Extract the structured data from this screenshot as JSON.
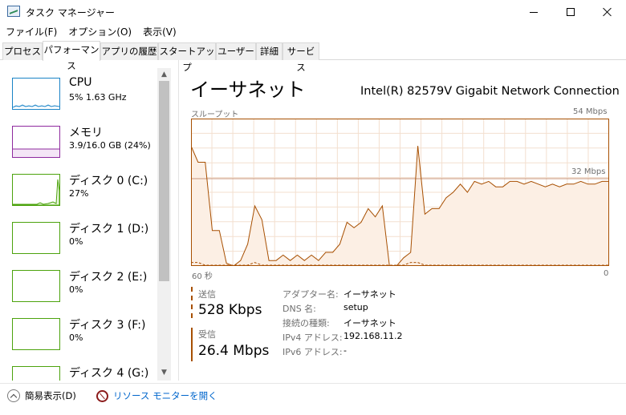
{
  "window": {
    "title": "タスク マネージャー"
  },
  "menu": [
    "ファイル(F)",
    "オプション(O)",
    "表示(V)"
  ],
  "tabs": [
    "プロセス",
    "パフォーマンス",
    "アプリの履歴",
    "スタートアップ",
    "ユーザー",
    "詳細",
    "サービス"
  ],
  "active_tab": "パフォーマンス",
  "resources": [
    {
      "name": "CPU",
      "sub": "5%  1.63 GHz",
      "color": "#1a83c6",
      "icon": "cpu-graph"
    },
    {
      "name": "メモリ",
      "sub": "3.9/16.0 GB (24%)",
      "color": "#8e2a9e",
      "icon": "memory-graph"
    },
    {
      "name": "ディスク 0 (C:)",
      "sub": "27%",
      "color": "#4ca30d",
      "icon": "disk-graph"
    },
    {
      "name": "ディスク 1 (D:)",
      "sub": "0%",
      "color": "#4ca30d",
      "icon": "disk-graph"
    },
    {
      "name": "ディスク 2 (E:)",
      "sub": "0%",
      "color": "#4ca30d",
      "icon": "disk-graph"
    },
    {
      "name": "ディスク 3 (F:)",
      "sub": "0%",
      "color": "#4ca30d",
      "icon": "disk-graph"
    },
    {
      "name": "ディスク 4 (G:)",
      "sub": "",
      "color": "#4ca30d",
      "icon": "disk-graph"
    }
  ],
  "network": {
    "title": "イーサネット",
    "adapter": "Intel(R) 82579V Gigabit Network Connection",
    "graph": {
      "label_top_left": "スループット",
      "label_top_right": "54 Mbps",
      "mid_label": "32 Mbps",
      "mid_value": 32,
      "max": 54,
      "label_bottom_left": "60 秒",
      "label_bottom_right": "0",
      "color": "#a74f01",
      "fill": "#fcefe4",
      "receive_series": [
        44,
        38,
        38,
        13,
        13,
        1,
        0,
        2,
        8,
        22,
        17,
        2,
        2,
        4,
        2,
        4,
        2,
        4,
        2,
        5,
        5,
        8,
        16,
        14,
        16,
        21,
        18,
        22,
        0,
        0,
        3,
        5,
        44,
        19,
        21,
        21,
        25,
        27,
        30,
        27,
        31,
        30,
        31,
        29,
        29,
        31,
        31,
        30,
        31,
        30,
        29,
        30,
        29,
        30,
        30,
        31,
        30,
        30,
        31,
        31
      ],
      "send_series": [
        1,
        1,
        0,
        0,
        0,
        0,
        0,
        0,
        0,
        1,
        0,
        0,
        0,
        0,
        0,
        0,
        0,
        0,
        0,
        0,
        0,
        0,
        0,
        0,
        0,
        0,
        0,
        0,
        0,
        0,
        0,
        1,
        1,
        0,
        0,
        0,
        0,
        0,
        0,
        0,
        0,
        0,
        0,
        0,
        0,
        0,
        0,
        0,
        0,
        0,
        0,
        0,
        0,
        0,
        0,
        0,
        0,
        0,
        0,
        0
      ]
    },
    "send": {
      "label": "送信",
      "value": "528 Kbps"
    },
    "receive": {
      "label": "受信",
      "value": "26.4 Mbps"
    },
    "details": [
      {
        "key": "アダプター名:",
        "value": "イーサネット"
      },
      {
        "key": "DNS 名:",
        "value": "setup"
      },
      {
        "key": "接続の種類:",
        "value": "イーサネット"
      },
      {
        "key": "IPv4 アドレス:",
        "value": "192.168.11.2"
      },
      {
        "key": "IPv6 アドレス:",
        "value": "-"
      }
    ]
  },
  "footer": {
    "fewer_details": "簡易表示(D)",
    "open_resmon": "リソース モニターを開く"
  }
}
